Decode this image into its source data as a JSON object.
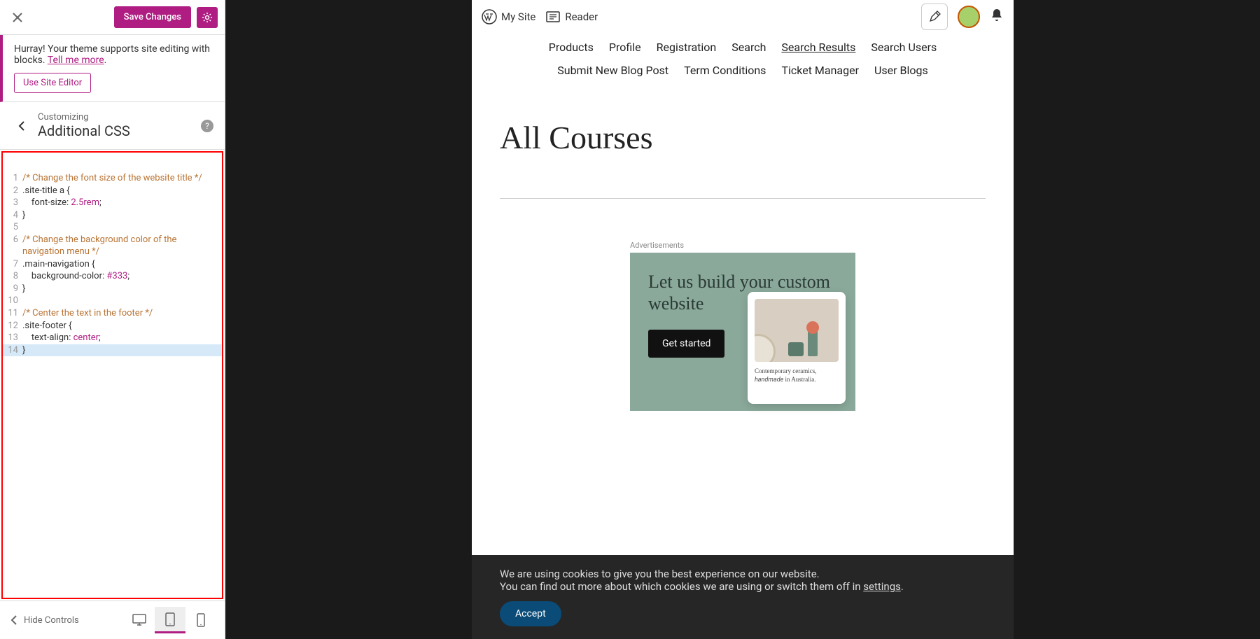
{
  "customizer": {
    "save_label": "Save Changes",
    "notice_text": "Hurray! Your theme supports site editing with blocks. ",
    "notice_link": "Tell me more",
    "site_editor_btn": "Use Site Editor",
    "section_sub": "Customizing",
    "section_main": "Additional CSS",
    "footer_hide": "Hide Controls"
  },
  "code": {
    "lines": [
      {
        "n": "1",
        "parts": [
          {
            "t": "/* Change the font size of the website title */",
            "c": "comment"
          }
        ]
      },
      {
        "n": "2",
        "parts": [
          {
            "t": ".site-title a ",
            "c": "selector"
          },
          {
            "t": "{",
            "c": "punct"
          }
        ]
      },
      {
        "n": "3",
        "parts": [
          {
            "t": "    font-size: ",
            "c": "prop"
          },
          {
            "t": "2.5rem",
            "c": "value"
          },
          {
            "t": ";",
            "c": "punct"
          }
        ]
      },
      {
        "n": "4",
        "parts": [
          {
            "t": "}",
            "c": "punct"
          }
        ]
      },
      {
        "n": "5",
        "parts": []
      },
      {
        "n": "6",
        "parts": [
          {
            "t": "/* Change the background color of the navigation menu */",
            "c": "comment"
          }
        ]
      },
      {
        "n": "7",
        "parts": [
          {
            "t": ".main-navigation ",
            "c": "selector"
          },
          {
            "t": "{",
            "c": "punct"
          }
        ]
      },
      {
        "n": "8",
        "parts": [
          {
            "t": "    background-color: ",
            "c": "prop"
          },
          {
            "t": "#333",
            "c": "value"
          },
          {
            "t": ";",
            "c": "punct"
          }
        ]
      },
      {
        "n": "9",
        "parts": [
          {
            "t": "}",
            "c": "punct"
          }
        ]
      },
      {
        "n": "10",
        "parts": []
      },
      {
        "n": "11",
        "parts": [
          {
            "t": "/* Center the text in the footer */",
            "c": "comment"
          }
        ]
      },
      {
        "n": "12",
        "parts": [
          {
            "t": ".site-footer ",
            "c": "selector"
          },
          {
            "t": "{",
            "c": "punct"
          }
        ]
      },
      {
        "n": "13",
        "parts": [
          {
            "t": "    text-align: ",
            "c": "prop"
          },
          {
            "t": "center",
            "c": "value"
          },
          {
            "t": ";",
            "c": "punct"
          }
        ]
      },
      {
        "n": "14",
        "parts": [
          {
            "t": "}",
            "c": "punct"
          }
        ],
        "hl": true
      }
    ]
  },
  "wpbar": {
    "my_site": "My Site",
    "reader": "Reader"
  },
  "nav": {
    "row1": [
      "Products",
      "Profile",
      "Registration",
      "Search",
      "Search Results",
      "Search Users"
    ],
    "row1_underline_index": 4,
    "row2": [
      "Submit New Blog Post",
      "Term Conditions",
      "Ticket Manager",
      "User Blogs"
    ]
  },
  "page": {
    "title": "All Courses"
  },
  "ad": {
    "label": "Advertisements",
    "headline": "Let us build your custom website",
    "cta": "Get started",
    "card_text": "Contemporary ceramics, handmade in Australia."
  },
  "cookie": {
    "line1": "We are using cookies to give you the best experience on our website.",
    "line2a": "You can find out more about which cookies we are using or switch them off in ",
    "line2_link": "settings",
    "accept": "Accept"
  }
}
